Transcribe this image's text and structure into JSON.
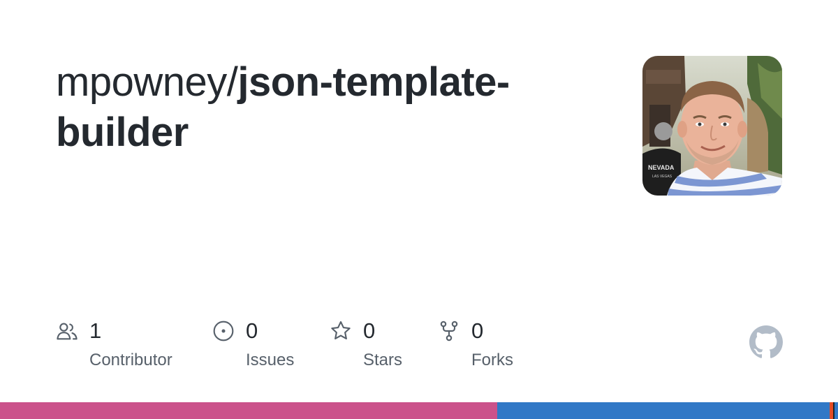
{
  "repo": {
    "owner": "mpowney/",
    "name": "json-template-builder"
  },
  "avatar": {
    "shirt_text": "NEVADA",
    "shirt_subtext": "LAS VEGAS"
  },
  "stats": [
    {
      "icon": "people-icon",
      "count": "1",
      "label": "Contributor"
    },
    {
      "icon": "issue-icon",
      "count": "0",
      "label": "Issues"
    },
    {
      "icon": "star-icon",
      "count": "0",
      "label": "Stars"
    },
    {
      "icon": "fork-icon",
      "count": "0",
      "label": "Forks"
    }
  ],
  "logo": {
    "icon": "github-icon"
  },
  "languages": [
    {
      "color": "#cb528b",
      "share": 0.593
    },
    {
      "color": "#3178c6",
      "share": 0.397
    },
    {
      "color": "#e34c26",
      "share": 0.004
    },
    {
      "color": "#1f2328",
      "share": 0.002
    },
    {
      "color": "#3178c6",
      "share": 0.004
    }
  ]
}
